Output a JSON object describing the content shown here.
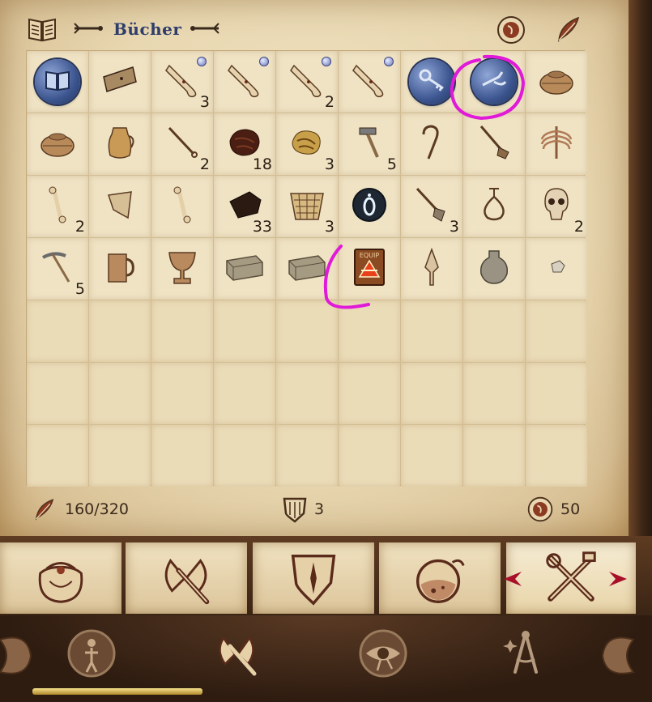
{
  "header": {
    "title": "Bücher"
  },
  "inventory": {
    "rows": [
      [
        {
          "icon": "book-orb-icon",
          "qty": "",
          "dot": false,
          "blue": true
        },
        {
          "icon": "wood-plank-icon",
          "qty": "",
          "dot": false,
          "blue": false
        },
        {
          "icon": "scroll-icon",
          "qty": "3",
          "dot": true,
          "blue": false
        },
        {
          "icon": "scroll-icon",
          "qty": "",
          "dot": true,
          "blue": false
        },
        {
          "icon": "scroll-icon",
          "qty": "2",
          "dot": true,
          "blue": false
        },
        {
          "icon": "scroll-icon",
          "qty": "",
          "dot": true,
          "blue": false
        },
        {
          "icon": "key-orb-icon",
          "qty": "",
          "dot": false,
          "blue": true
        },
        {
          "icon": "lockpick-orb-icon",
          "qty": "",
          "dot": false,
          "blue": true
        },
        {
          "icon": "clay-pot-icon",
          "qty": "",
          "dot": false,
          "blue": false
        }
      ],
      [
        {
          "icon": "clay-pot-icon",
          "qty": "",
          "dot": false,
          "blue": false
        },
        {
          "icon": "jug-icon",
          "qty": "",
          "dot": false,
          "blue": false
        },
        {
          "icon": "rod-icon",
          "qty": "2",
          "dot": false,
          "blue": false
        },
        {
          "icon": "dark-ore-icon",
          "qty": "18",
          "dot": false,
          "blue": false
        },
        {
          "icon": "gold-ore-icon",
          "qty": "3",
          "dot": false,
          "blue": false
        },
        {
          "icon": "hammer-icon",
          "qty": "5",
          "dot": false,
          "blue": false
        },
        {
          "icon": "hook-icon",
          "qty": "",
          "dot": false,
          "blue": false
        },
        {
          "icon": "shovel-icon",
          "qty": "",
          "dot": false,
          "blue": false
        },
        {
          "icon": "ribcage-icon",
          "qty": "",
          "dot": false,
          "blue": false
        }
      ],
      [
        {
          "icon": "bone-icon",
          "qty": "2",
          "dot": false,
          "blue": false
        },
        {
          "icon": "shoulder-bone-icon",
          "qty": "",
          "dot": false,
          "blue": false
        },
        {
          "icon": "bone-icon",
          "qty": "",
          "dot": false,
          "blue": false
        },
        {
          "icon": "coal-icon",
          "qty": "33",
          "dot": false,
          "blue": false
        },
        {
          "icon": "basket-icon",
          "qty": "3",
          "dot": false,
          "blue": false
        },
        {
          "icon": "dial-icon",
          "qty": "",
          "dot": false,
          "blue": false
        },
        {
          "icon": "spade-icon",
          "qty": "3",
          "dot": false,
          "blue": false
        },
        {
          "icon": "ankh-icon",
          "qty": "",
          "dot": false,
          "blue": false
        },
        {
          "icon": "skull-icon",
          "qty": "2",
          "dot": false,
          "blue": false
        }
      ],
      [
        {
          "icon": "pickaxe-icon",
          "qty": "5",
          "dot": false,
          "blue": false
        },
        {
          "icon": "mug-icon",
          "qty": "",
          "dot": false,
          "blue": false
        },
        {
          "icon": "goblet-icon",
          "qty": "",
          "dot": false,
          "blue": false
        },
        {
          "icon": "brick-icon",
          "qty": "",
          "dot": false,
          "blue": false
        },
        {
          "icon": "brick-icon",
          "qty": "",
          "dot": false,
          "blue": false
        },
        {
          "icon": "equip-box-icon",
          "qty": "",
          "dot": false,
          "blue": false
        },
        {
          "icon": "arrowhead-icon",
          "qty": "",
          "dot": false,
          "blue": false
        },
        {
          "icon": "pottery-icon",
          "qty": "",
          "dot": false,
          "blue": false
        },
        {
          "icon": "small-stone-icon",
          "qty": "",
          "dot": false,
          "blue": false
        }
      ]
    ],
    "empty_rows": 3
  },
  "footer": {
    "weight": "160/320",
    "armor": "3",
    "gold": "50"
  },
  "tabs": [
    "bag-icon",
    "axe-icon",
    "shield-icon",
    "potion-icon",
    "tools-icon"
  ],
  "nav": [
    "character-icon",
    "weapon-nav-icon",
    "eye-icon",
    "compass-icon"
  ],
  "colors": {
    "title": "#2f3d6b",
    "parchment": "#efe3c4",
    "accent": "#a8102a"
  }
}
